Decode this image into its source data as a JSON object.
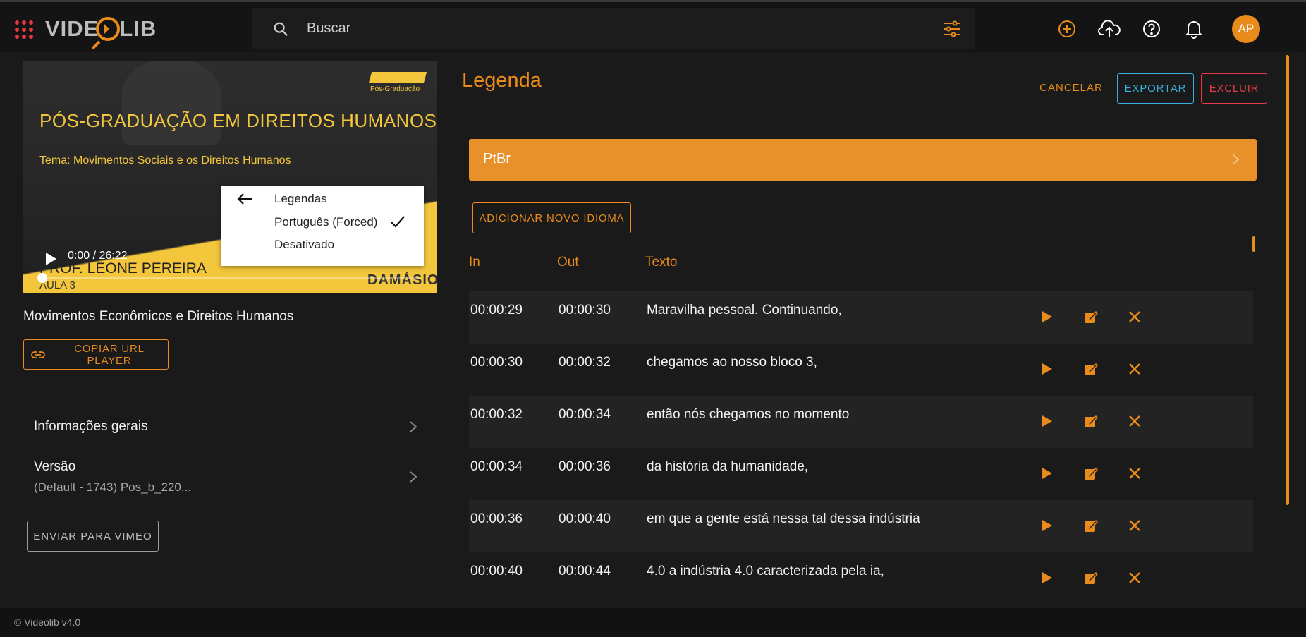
{
  "app": {
    "logo_text": "VIDEOLIB",
    "brand_color": "#e88b1a",
    "search_placeholder": "Buscar",
    "user_initials": "AP",
    "icons": [
      "apps-grid-icon",
      "search-icon",
      "filter-sliders-icon",
      "add-circle-icon",
      "cloud-upload-icon",
      "help-icon",
      "bell-icon"
    ]
  },
  "player": {
    "slide_badge": "Pós-Graduação",
    "slide_title": "PÓS-GRADUAÇÃO EM DIREITOS HUMANOS",
    "slide_theme": "Tema: Movimentos Sociais e os Direitos Humanos",
    "slide_professor": "PROF. LEONE PEREIRA",
    "slide_lesson": "AULA 3",
    "slide_brand": "DAMÁSIO",
    "time": "0:00 / 26:22",
    "progress_fraction": 0.0,
    "cc_menu": {
      "back_label": "Legendas",
      "options": [
        {
          "label": "Português (Forced)",
          "selected": true
        },
        {
          "label": "Desativado",
          "selected": false
        }
      ]
    }
  },
  "left": {
    "video_title": "Movimentos Econômicos e Direitos Humanos",
    "copy_url_label": "COPIAR URL PLAYER",
    "info_general_label": "Informações gerais",
    "version_label": "Versão",
    "version_value": "(Default - 1743) Pos_b_220...",
    "send_vimeo_label": "ENVIAR PARA VIMEO"
  },
  "right": {
    "title": "Legenda",
    "cancel_label": "CANCELAR",
    "export_label": "EXPORTAR",
    "delete_label": "EXCLUIR",
    "language": "PtBr",
    "add_language_label": "ADICIONAR NOVO IDIOMA",
    "columns": {
      "in": "In",
      "out": "Out",
      "text": "Texto"
    },
    "rows": [
      {
        "in": "00:00:29",
        "out": "00:00:30",
        "text": "Maravilha pessoal. Continuando,"
      },
      {
        "in": "00:00:30",
        "out": "00:00:32",
        "text": "chegamos ao nosso bloco 3,"
      },
      {
        "in": "00:00:32",
        "out": "00:00:34",
        "text": "então nós chegamos no momento"
      },
      {
        "in": "00:00:34",
        "out": "00:00:36",
        "text": "da história da humanidade,"
      },
      {
        "in": "00:00:36",
        "out": "00:00:40",
        "text": "em que a gente está nessa tal dessa indústria"
      },
      {
        "in": "00:00:40",
        "out": "00:00:44",
        "text": "4.0 a indústria 4.0 caracterizada pela ia,"
      }
    ],
    "row_actions": [
      "play-icon",
      "edit-icon",
      "delete-icon"
    ]
  },
  "footer": {
    "text": "© Videolib v4.0"
  }
}
